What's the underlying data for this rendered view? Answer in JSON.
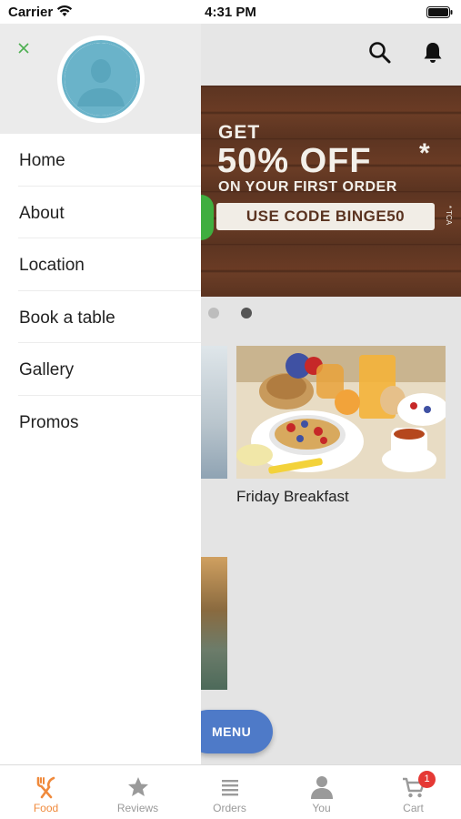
{
  "status_bar": {
    "carrier": "Carrier",
    "time": "4:31 PM"
  },
  "header": {
    "search_icon": "search-icon",
    "bell_icon": "bell-icon"
  },
  "promo": {
    "line1": "GET",
    "line2": "50% OFF",
    "star": "*",
    "line3": "ON YOUR FIRST ORDER",
    "code_text": "USE CODE BINGE50",
    "tca": "* TCA"
  },
  "carousel": {
    "dots": 2,
    "active_index": 1
  },
  "food_cards": [
    {
      "title": "Friday Breakfast"
    }
  ],
  "fab": {
    "label": "MENU"
  },
  "drawer": {
    "items": [
      {
        "label": "Home"
      },
      {
        "label": "About"
      },
      {
        "label": "Location"
      },
      {
        "label": "Book a table"
      },
      {
        "label": "Gallery"
      },
      {
        "label": "Promos"
      }
    ]
  },
  "tabs": [
    {
      "label": "Food",
      "icon": "fork-knife-icon",
      "active": true
    },
    {
      "label": "Reviews",
      "icon": "star-icon",
      "active": false
    },
    {
      "label": "Orders",
      "icon": "list-icon",
      "active": false
    },
    {
      "label": "You",
      "icon": "person-icon",
      "active": false
    },
    {
      "label": "Cart",
      "icon": "cart-icon",
      "active": false,
      "badge": "1"
    }
  ],
  "colors": {
    "accent": "#f08a3c",
    "fab": "#4e7ac8",
    "avatar_ring": "#6ab3c9",
    "close": "#4caf50",
    "badge": "#e53935"
  }
}
